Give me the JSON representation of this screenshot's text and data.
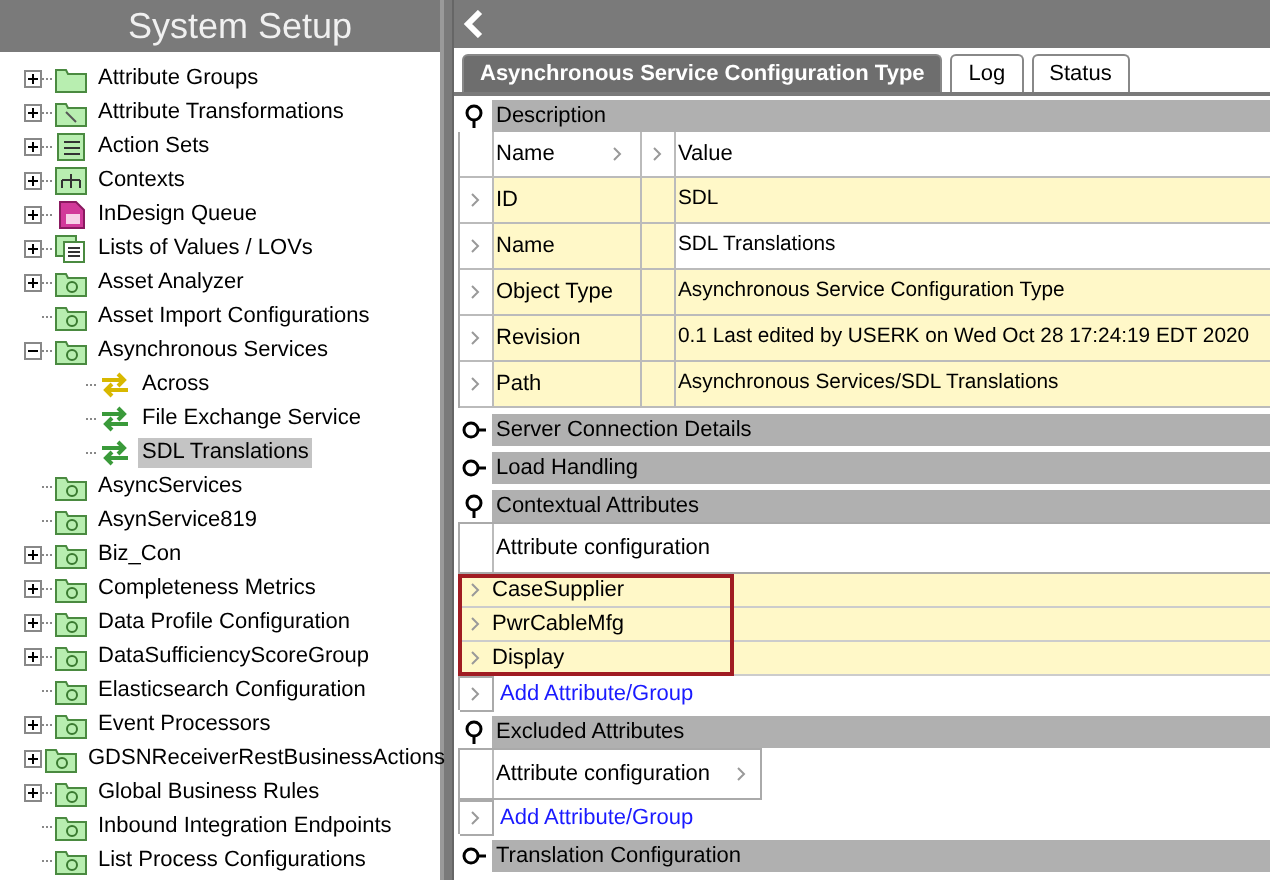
{
  "sidebar": {
    "title": "System Setup",
    "tree": [
      {
        "label": "Attribute Groups",
        "kind": "folder",
        "has_children": true,
        "expanded": false,
        "selected": false
      },
      {
        "label": "Attribute Transformations",
        "kind": "folder-search",
        "has_children": true,
        "expanded": false,
        "selected": false
      },
      {
        "label": "Action Sets",
        "kind": "checklist",
        "has_children": true,
        "expanded": false,
        "selected": false
      },
      {
        "label": "Contexts",
        "kind": "hierarchy",
        "has_children": true,
        "expanded": false,
        "selected": false
      },
      {
        "label": "InDesign Queue",
        "kind": "document",
        "has_children": true,
        "expanded": false,
        "selected": false
      },
      {
        "label": "Lists of Values / LOVs",
        "kind": "list",
        "has_children": true,
        "expanded": false,
        "selected": false
      },
      {
        "label": "Asset Analyzer",
        "kind": "folder-gear",
        "has_children": true,
        "expanded": false,
        "selected": false
      },
      {
        "label": "Asset Import Configurations",
        "kind": "folder-gear",
        "has_children": false,
        "selected": false
      },
      {
        "label": "Asynchronous Services",
        "kind": "folder-gear",
        "has_children": true,
        "expanded": true,
        "selected": false,
        "children": [
          {
            "label": "Across",
            "kind": "exchange-alt",
            "has_children": false,
            "selected": false
          },
          {
            "label": "File Exchange Service",
            "kind": "exchange",
            "has_children": false,
            "selected": false
          },
          {
            "label": "SDL Translations",
            "kind": "exchange",
            "has_children": false,
            "selected": true
          }
        ]
      },
      {
        "label": "AsyncServices",
        "kind": "folder-gear",
        "has_children": false,
        "selected": false
      },
      {
        "label": "AsynService819",
        "kind": "folder-gear",
        "has_children": false,
        "selected": false
      },
      {
        "label": "Biz_Con",
        "kind": "folder-gear",
        "has_children": true,
        "expanded": false,
        "selected": false
      },
      {
        "label": "Completeness Metrics",
        "kind": "folder-gear",
        "has_children": true,
        "expanded": false,
        "selected": false
      },
      {
        "label": "Data Profile Configuration",
        "kind": "folder-gear",
        "has_children": true,
        "expanded": false,
        "selected": false
      },
      {
        "label": "DataSufficiencyScoreGroup",
        "kind": "folder-gear",
        "has_children": true,
        "expanded": false,
        "selected": false
      },
      {
        "label": "Elasticsearch Configuration",
        "kind": "folder-gear",
        "has_children": false,
        "selected": false
      },
      {
        "label": "Event Processors",
        "kind": "folder-gear",
        "has_children": true,
        "expanded": false,
        "selected": false
      },
      {
        "label": "GDSNReceiverRestBusinessActions",
        "kind": "folder-gear",
        "has_children": true,
        "expanded": false,
        "selected": false
      },
      {
        "label": "Global Business Rules",
        "kind": "folder-gear",
        "has_children": true,
        "expanded": false,
        "selected": false
      },
      {
        "label": "Inbound Integration Endpoints",
        "kind": "folder-gear",
        "has_children": false,
        "selected": false
      },
      {
        "label": "List Process Configurations",
        "kind": "folder-gear",
        "has_children": false,
        "selected": false
      }
    ]
  },
  "tabs": [
    {
      "label": "Asynchronous Service Configuration Type",
      "selected": true
    },
    {
      "label": "Log",
      "selected": false
    },
    {
      "label": "Status",
      "selected": false
    }
  ],
  "sections": [
    {
      "title": "Description",
      "expanded": true,
      "kind": "table",
      "columns": [
        "Name",
        "Value"
      ],
      "rows": [
        {
          "name": "ID",
          "value": "SDL",
          "shaded": true
        },
        {
          "name": "Name",
          "value": "SDL Translations",
          "shaded": false
        },
        {
          "name": "Object Type",
          "value": "Asynchronous Service Configuration Type",
          "shaded": true
        },
        {
          "name": "Revision",
          "value": "0.1 Last edited by USERK on Wed Oct 28 17:24:19 EDT 2020",
          "shaded": true
        },
        {
          "name": "Path",
          "value": "Asynchronous Services/SDL Translations",
          "shaded": true
        }
      ]
    },
    {
      "title": "Server Connection Details",
      "expanded": false,
      "kind": "none"
    },
    {
      "title": "Load Handling",
      "expanded": false,
      "kind": "none"
    },
    {
      "title": "Contextual Attributes",
      "expanded": true,
      "kind": "attributes",
      "header": "Attribute configuration",
      "full_width": true,
      "highlighted": true,
      "items": [
        "CaseSupplier",
        "PwrCableMfg",
        "Display"
      ],
      "add_link": "Add Attribute/Group"
    },
    {
      "title": "Excluded Attributes",
      "expanded": true,
      "kind": "attributes",
      "header": "Attribute configuration",
      "full_width": false,
      "add_link": "Add Attribute/Group"
    },
    {
      "title": "Translation Configuration",
      "expanded": false,
      "kind": "none"
    }
  ]
}
